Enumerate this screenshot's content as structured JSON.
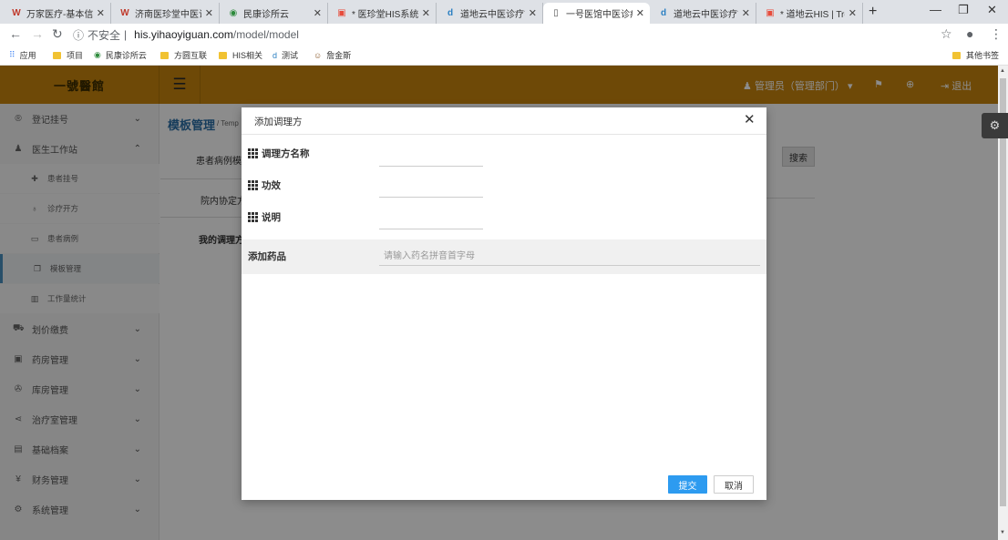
{
  "browser": {
    "tabs": [
      {
        "label": "万家医疗-基本信息",
        "icon": "W",
        "icon_color": "#c0392b"
      },
      {
        "label": "济南医珍堂中医诊",
        "icon": "W",
        "icon_color": "#c0392b"
      },
      {
        "label": "民康诊所云",
        "icon": "◉",
        "icon_color": "#2e8b3d"
      },
      {
        "label": "* 医珍堂HIS系统",
        "icon": "▣",
        "icon_color": "#e74c3c"
      },
      {
        "label": "道地云中医诊疗管",
        "icon": "d",
        "icon_color": "#2a7fc2"
      },
      {
        "label": "一号医馆中医诊疗",
        "icon": "▯",
        "icon_color": "#555555"
      },
      {
        "label": "道地云中医诊疗管",
        "icon": "d",
        "icon_color": "#2a7fc2"
      },
      {
        "label": "* 道地云HIS | Trel",
        "icon": "▣",
        "icon_color": "#e74c3c"
      }
    ],
    "security_label": "不安全",
    "url_host": "his.yihaoyiguan.com",
    "url_path": "/model/model",
    "bookmarks": [
      {
        "label": "应用"
      },
      {
        "label": "项目"
      },
      {
        "label": "民康诊所云"
      },
      {
        "label": "方圆互联"
      },
      {
        "label": "HIS相关"
      },
      {
        "label": "测试"
      },
      {
        "label": "詹金斯"
      }
    ],
    "other_bookmarks": "其他书签"
  },
  "header": {
    "brand": "一號醫館",
    "user": "管理员（管理部门）",
    "logout": "退出"
  },
  "sidebar": {
    "items": [
      {
        "label": "登记挂号",
        "icon": "®"
      },
      {
        "label": "医生工作站",
        "icon": "♟"
      },
      {
        "label": "划价缴费",
        "icon": "🛒"
      },
      {
        "label": "药房管理",
        "icon": "▣"
      },
      {
        "label": "库房管理",
        "icon": "✇"
      },
      {
        "label": "治疗室管理",
        "icon": "⋖"
      },
      {
        "label": "基础档案",
        "icon": "▤"
      },
      {
        "label": "财务管理",
        "icon": "¥"
      },
      {
        "label": "系统管理",
        "icon": "⚙"
      }
    ],
    "subitems": [
      {
        "label": "患者挂号",
        "icon": "✚"
      },
      {
        "label": "诊疗开方",
        "icon": "♁"
      },
      {
        "label": "患者病例",
        "icon": "▭"
      },
      {
        "label": "模板管理",
        "icon": "❐"
      },
      {
        "label": "工作量统计",
        "icon": "▥"
      }
    ]
  },
  "main": {
    "title": "模板管理",
    "crumb": "/ Temp",
    "rows": [
      "患者病例模",
      "院内协定方",
      "我的调理方"
    ],
    "search_button": "搜索"
  },
  "modal": {
    "title": "添加调理方",
    "fields": [
      {
        "label": "调理方名称",
        "value": ""
      },
      {
        "label": "功效",
        "value": ""
      },
      {
        "label": "说明",
        "value": ""
      }
    ],
    "drug_label": "添加药品",
    "drug_placeholder": "请输入药名拼音首字母",
    "submit": "提交",
    "cancel": "取消"
  }
}
